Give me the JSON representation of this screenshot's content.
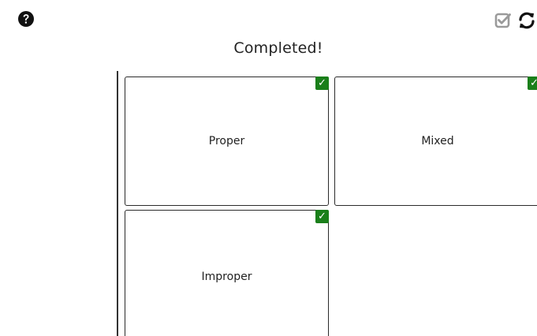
{
  "toolbar": {
    "help_icon": "question-circle-icon",
    "check_icon": "checkbox-check-icon",
    "refresh_icon": "refresh-icon"
  },
  "status": {
    "text": "Completed!"
  },
  "cards": [
    {
      "label": "Proper",
      "checked": true
    },
    {
      "label": "Mixed",
      "checked": true
    },
    {
      "label": "Improper",
      "checked": true
    }
  ],
  "check_glyph": "✓",
  "colors": {
    "check_badge": "#1a7f1a",
    "text": "#222222",
    "check_button": "#9a9a9a"
  }
}
